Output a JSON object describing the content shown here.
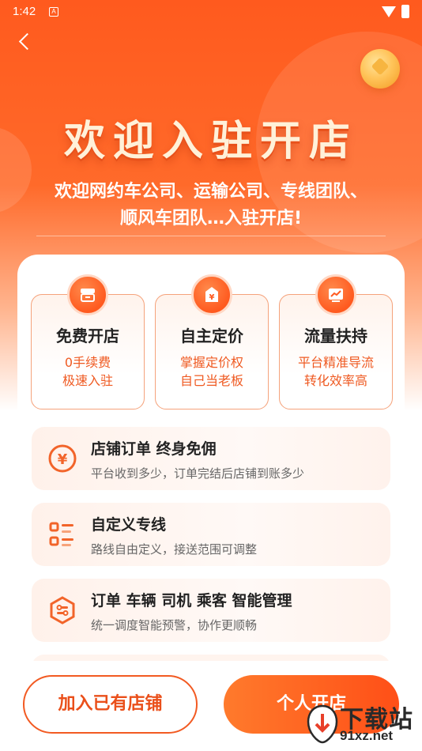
{
  "status_bar": {
    "time": "1:42",
    "notif_letter": "A"
  },
  "header": {
    "title": "欢迎入驻开店",
    "subtitle_line1": "欢迎网约车公司、运输公司、专线团队、",
    "subtitle_line2": "顺风车团队…入驻开店!"
  },
  "features": [
    {
      "icon": "store-icon",
      "title": "免费开店",
      "line1": "0手续费",
      "line2": "极速入驻"
    },
    {
      "icon": "price-tag-icon",
      "title": "自主定价",
      "line1": "掌握定价权",
      "line2": "自己当老板"
    },
    {
      "icon": "trend-chart-icon",
      "title": "流量扶持",
      "line1": "平台精准导流",
      "line2": "转化效率高"
    }
  ],
  "rows": [
    {
      "icon": "yuan-coin-icon",
      "title": "店铺订单 终身免佣",
      "desc": "平台收到多少，订单完结后店铺到账多少"
    },
    {
      "icon": "route-list-icon",
      "title": "自定义专线",
      "desc": "路线自由定义，接送范围可调整"
    },
    {
      "icon": "smart-manage-icon",
      "title": "订单 车辆 司机 乘客 智能管理",
      "desc": "统一调度智能预警，协作更顺畅"
    }
  ],
  "buttons": {
    "join": "加入已有店铺",
    "open": "个人开店"
  },
  "watermark": {
    "top": "下载站",
    "bottom": "91xz.net"
  },
  "colors": {
    "primary": "#ff5a1e",
    "accent_text": "#ef5a22",
    "title_cream": "#fff1d9"
  }
}
